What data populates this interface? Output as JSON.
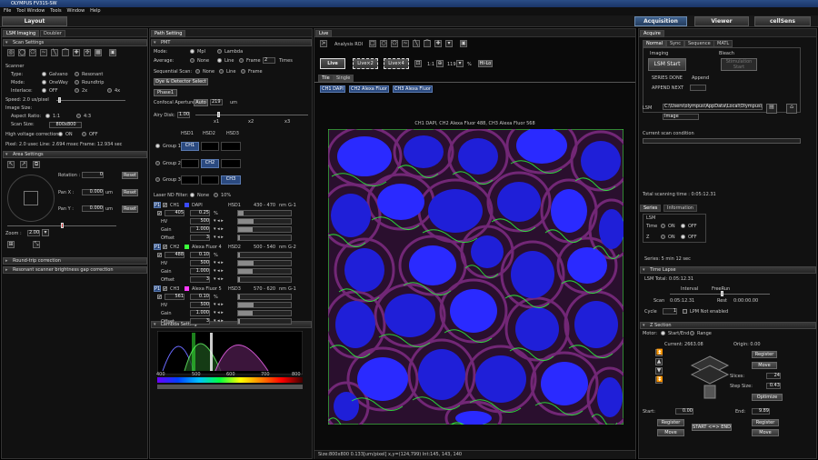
{
  "window": {
    "title": "OLYMPUS FV31S-SW"
  },
  "menu": [
    "File",
    "Tool Window",
    "Tools",
    "Window",
    "Help"
  ],
  "top": {
    "layout": "Layout",
    "acquisition": "Acquisition",
    "viewer": "Viewer",
    "cellsens": "cellSens"
  },
  "left": {
    "tabs": [
      "LSM Imaging",
      "Doubler"
    ],
    "scan_header": "Scan Settings",
    "scanner": "Scanner",
    "type": "Type:",
    "galvano": "Galvano",
    "resonant": "Resonant",
    "mode": "Mode:",
    "oneway": "OneWay",
    "roundtrip": "Roundtrip",
    "interlace": "Interlace:",
    "off": "OFF",
    "x2": "2x",
    "x4": "4x",
    "speed": "Speed: 2.0 us/pixel",
    "image_size": "Image Size:",
    "aspect": "Aspect Ratio:",
    "r11": "1:1",
    "r43": "4:3",
    "scan_size": "Scan Size:",
    "scan_size_val": "800x800",
    "hv": "High voltage correction:",
    "on": "ON",
    "off2": "OFF",
    "pixel": "Pixel: 2.0 usec Line: 2.694 msec Frame: 12.934 sec",
    "area_header": "Area Settings",
    "rotation": "Rotation :",
    "rotation_val": "0",
    "reset": "Reset",
    "panx": "Pan X :",
    "panx_val": "0.000",
    "pany": "Pan Y :",
    "pany_val": "0.000",
    "um": "um",
    "zoom": "Zoom :",
    "zoom_val": "2.00",
    "roundtrip_corr": "Round-trip correction",
    "resonant_corr": "Resonant scanner brightness gap correction"
  },
  "mid": {
    "tab": "Path Setting",
    "pmt": "PMT",
    "mode": "Mode:",
    "mpl": "MpI",
    "lambda": "Lambda",
    "average": "Average:",
    "none": "None",
    "line": "Line",
    "frame": "Frame",
    "avg_val": "2",
    "times": "Times",
    "seq": "Sequential Scan:",
    "dye_btn": "Dye & Detector Select",
    "phase": "Phase1",
    "confocal": "Confocal Aperture",
    "auto": "Auto",
    "ca_val": "219",
    "um": "um",
    "airy": "Airy Disk:",
    "airy_val": "1.00",
    "ticks": [
      "x1",
      "x2",
      "x3"
    ],
    "hsd": [
      "HSD1",
      "HSD2",
      "HSD3"
    ],
    "groups": [
      "Group 1",
      "Group 2",
      "Group 3"
    ],
    "ch_labels": [
      "CH1",
      "CH2",
      "CH3"
    ],
    "laser_nd": "Laser ND Filter:",
    "nd_none": "None",
    "nd_10": "10%",
    "channels": [
      {
        "num": "P1",
        "ch": "CH1",
        "dye": "DAPI",
        "det": "HSD1",
        "range": "430 - 470",
        "nm": "nm",
        "g": "G-1",
        "laser": "405",
        "pct": "0.25",
        "hv": "500",
        "gain": "1.000",
        "offset": "3",
        "color": "#3a4aff"
      },
      {
        "num": "P1",
        "ch": "CH2",
        "dye": "Alexa Fluor 4",
        "det": "HSD2",
        "range": "500 - 540",
        "nm": "nm",
        "g": "G-2",
        "laser": "488",
        "pct": "0.10",
        "hv": "500",
        "gain": "1.000",
        "offset": "3",
        "color": "#3aff3a"
      },
      {
        "num": "P1",
        "ch": "CH3",
        "dye": "Alexa Fluor 5",
        "det": "HSD3",
        "range": "570 - 620",
        "nm": "nm",
        "g": "G-1",
        "laser": "561",
        "pct": "0.10",
        "hv": "500",
        "gain": "1.000",
        "offset": "3",
        "color": "#ff3aff"
      }
    ],
    "hv": "HV",
    "gain": "Gain",
    "offset": "Offset",
    "x": "%",
    "lambda_header": "Lambda Setting",
    "spec_ticks": [
      "400",
      "500",
      "600",
      "700",
      "800"
    ]
  },
  "view": {
    "tab": "Live",
    "toolbar_label": "Analysis ROI",
    "live": "Live",
    "live2": "Live×2",
    "live4": "Live×4",
    "x1": "1:1",
    "zoom": "119",
    "percent": "%",
    "hilo": "Hi-Lo",
    "tabs": [
      "Tile",
      "Single"
    ],
    "chtabs": [
      "CH1 DAPI",
      "CH2 Alexa Fluor",
      "CH3 Alexa Fluor"
    ],
    "image_title": "CH1 DAPI, CH2 Alexa Fluor 488, CH3 Alexa Fluor 568",
    "status": "Size:800x800  0.133[um/pixel]  x,y=(124,799)  Int:145, 143, 140"
  },
  "right": {
    "tab": "Acquire",
    "subtabs": [
      "Normal",
      "Sync",
      "Sequence",
      "MATL"
    ],
    "imaging": "Imaging",
    "lsm_start": "LSM Start",
    "bleach": "Bleach",
    "stim_start": "Stimulation Start",
    "series_done": "SERIES DONE",
    "append": "Append",
    "append_next": "APPEND NEXT",
    "lsm": "LSM",
    "path": "C:\\Users\\olympus\\AppData\\Local\\Olympus\\",
    "image": "Image",
    "current": "Current scan condition",
    "total_time": "Total scanning time :  0:05:12.31",
    "series_tab": "Series",
    "info_tab": "Information",
    "lsm_hdr": "LSM",
    "time": "Time",
    "z": "Z",
    "on": "ON",
    "off": "OFF",
    "series_text": "Series: 5 min 12 sec",
    "timelapse": "Time Lapse",
    "lsm_total": "LSM Total:  0:05:12.31",
    "interval": "Interval",
    "freerun": "FreeRun",
    "scan": "Scan",
    "scan_val": "0:05:12.31",
    "rest": "Rest",
    "rest_val": "0:00:00.00",
    "cycle": "Cycle",
    "cycle_val": "1",
    "lpm": "LPM Not enabled",
    "zsection": "Z Section",
    "motor": "Motor:",
    "startend": "Start/End",
    "range": "Range",
    "current_val": "Current: 2663.08",
    "origin": "Origin: 0.00",
    "register": "Register",
    "move": "Move",
    "slices": "Slices:",
    "slices_val": "24",
    "step": "Step Size:",
    "step_val": "0.43",
    "optimize": "Optimize",
    "start": "Start:",
    "start_val": "0.00",
    "end": "End:",
    "end_val": "9.89",
    "start_end": "START <=> END"
  }
}
